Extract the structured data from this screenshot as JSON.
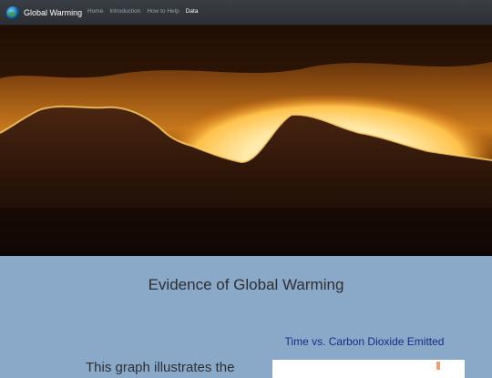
{
  "navbar": {
    "brand": "Global Warming",
    "links": [
      "Home",
      "Introduction",
      "How to Help",
      "Data"
    ],
    "active": "Data"
  },
  "main": {
    "heading": "Evidence of Global Warming",
    "graph_title": "Time vs. Carbon Dioxide Emitted",
    "intro_text": "This graph illustrates the"
  }
}
